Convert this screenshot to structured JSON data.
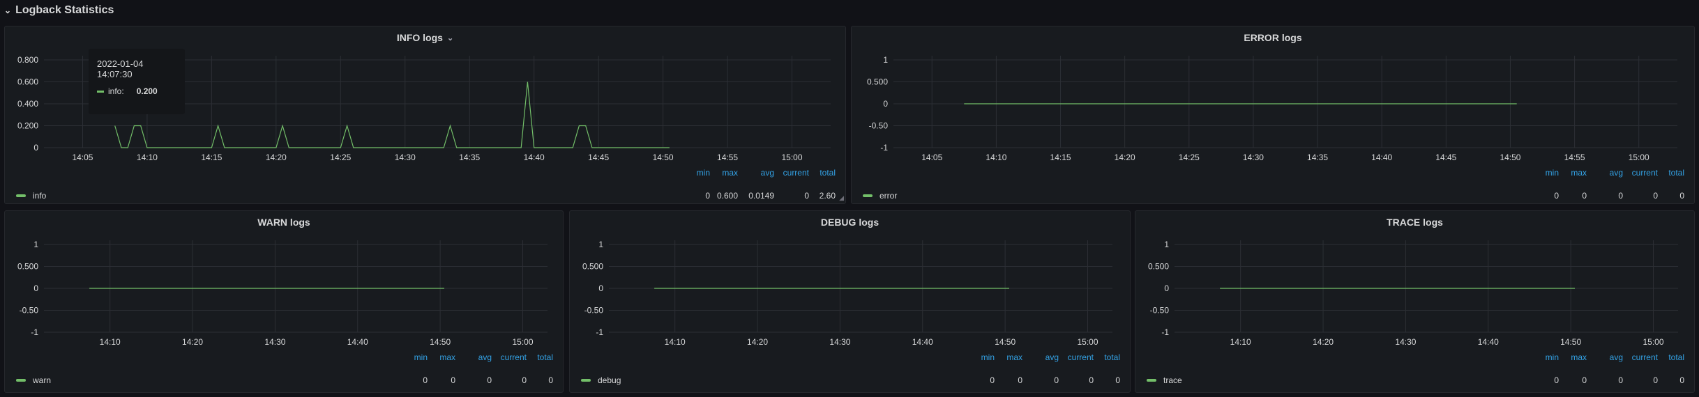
{
  "row": {
    "title": "Logback Statistics",
    "chevron_icon": "chevron-down-icon"
  },
  "colors": {
    "series": "#73bf69",
    "grid": "#2c2f35",
    "stat_header": "#33a2e5",
    "background": "#111217",
    "panel": "#181b1f"
  },
  "stat_headers": {
    "min": "min",
    "max": "max",
    "avg": "avg",
    "current": "current",
    "total": "total"
  },
  "tooltip": {
    "time": "2022-01-04 14:07:30",
    "series": "info:",
    "value": "0.200"
  },
  "panels": [
    {
      "title": "INFO logs",
      "has_menu": true,
      "legend": "info",
      "stats": {
        "min": "0",
        "max": "0.600",
        "avg": "0.0149",
        "current": "0",
        "total": "2.60"
      }
    },
    {
      "title": "ERROR logs",
      "has_menu": false,
      "legend": "error",
      "stats": {
        "min": "0",
        "max": "0",
        "avg": "0",
        "current": "0",
        "total": "0"
      }
    },
    {
      "title": "WARN logs",
      "has_menu": false,
      "legend": "warn",
      "stats": {
        "min": "0",
        "max": "0",
        "avg": "0",
        "current": "0",
        "total": "0"
      }
    },
    {
      "title": "DEBUG logs",
      "has_menu": false,
      "legend": "debug",
      "stats": {
        "min": "0",
        "max": "0",
        "avg": "0",
        "current": "0",
        "total": "0"
      }
    },
    {
      "title": "TRACE logs",
      "has_menu": false,
      "legend": "trace",
      "stats": {
        "min": "0",
        "max": "0",
        "avg": "0",
        "current": "0",
        "total": "0"
      }
    }
  ],
  "chart_data": [
    {
      "type": "line",
      "title": "INFO logs",
      "ylim": [
        0,
        0.8
      ],
      "yticks": [
        "0",
        "0.200",
        "0.400",
        "0.600",
        "0.800"
      ],
      "xticks": [
        "14:05",
        "14:10",
        "14:15",
        "14:20",
        "14:25",
        "14:30",
        "14:35",
        "14:40",
        "14:45",
        "14:50",
        "14:55",
        "15:00"
      ],
      "xlim": [
        "14:02",
        "15:03"
      ],
      "series": [
        {
          "name": "info",
          "x": [
            "14:07:30",
            "14:08",
            "14:08:30",
            "14:09",
            "14:09:30",
            "14:10",
            "14:15",
            "14:15:30",
            "14:16",
            "14:20",
            "14:20:30",
            "14:21",
            "14:25",
            "14:25:30",
            "14:26",
            "14:33",
            "14:33:30",
            "14:34",
            "14:39",
            "14:39:30",
            "14:40",
            "14:43",
            "14:43:30",
            "14:44",
            "14:44:30",
            "14:50:30"
          ],
          "values": [
            0.2,
            0,
            0,
            0.2,
            0.2,
            0,
            0,
            0.2,
            0,
            0,
            0.2,
            0,
            0,
            0.2,
            0,
            0,
            0.2,
            0,
            0,
            0.6,
            0,
            0,
            0.2,
            0.2,
            0,
            0
          ]
        }
      ]
    },
    {
      "type": "line",
      "title": "ERROR logs",
      "ylim": [
        -1,
        1
      ],
      "yticks": [
        "-1",
        "-0.50",
        "0",
        "0.500",
        "1"
      ],
      "xticks": [
        "14:05",
        "14:10",
        "14:15",
        "14:20",
        "14:25",
        "14:30",
        "14:35",
        "14:40",
        "14:45",
        "14:50",
        "14:55",
        "15:00"
      ],
      "xlim": [
        "14:02",
        "15:03"
      ],
      "series": [
        {
          "name": "error",
          "x": [
            "14:07:30",
            "14:50:30"
          ],
          "values": [
            0,
            0
          ]
        }
      ]
    },
    {
      "type": "line",
      "title": "WARN logs",
      "ylim": [
        -1,
        1
      ],
      "yticks": [
        "-1",
        "-0.50",
        "0",
        "0.500",
        "1"
      ],
      "xticks": [
        "14:10",
        "14:20",
        "14:30",
        "14:40",
        "14:50",
        "15:00"
      ],
      "xlim": [
        "14:02",
        "15:03"
      ],
      "series": [
        {
          "name": "warn",
          "x": [
            "14:07:30",
            "14:50:30"
          ],
          "values": [
            0,
            0
          ]
        }
      ]
    },
    {
      "type": "line",
      "title": "DEBUG logs",
      "ylim": [
        -1,
        1
      ],
      "yticks": [
        "-1",
        "-0.50",
        "0",
        "0.500",
        "1"
      ],
      "xticks": [
        "14:10",
        "14:20",
        "14:30",
        "14:40",
        "14:50",
        "15:00"
      ],
      "xlim": [
        "14:02",
        "15:03"
      ],
      "series": [
        {
          "name": "debug",
          "x": [
            "14:07:30",
            "14:50:30"
          ],
          "values": [
            0,
            0
          ]
        }
      ]
    },
    {
      "type": "line",
      "title": "TRACE logs",
      "ylim": [
        -1,
        1
      ],
      "yticks": [
        "-1",
        "-0.50",
        "0",
        "0.500",
        "1"
      ],
      "xticks": [
        "14:10",
        "14:20",
        "14:30",
        "14:40",
        "14:50",
        "15:00"
      ],
      "xlim": [
        "14:02",
        "15:03"
      ],
      "series": [
        {
          "name": "trace",
          "x": [
            "14:07:30",
            "14:50:30"
          ],
          "values": [
            0,
            0
          ]
        }
      ]
    }
  ]
}
